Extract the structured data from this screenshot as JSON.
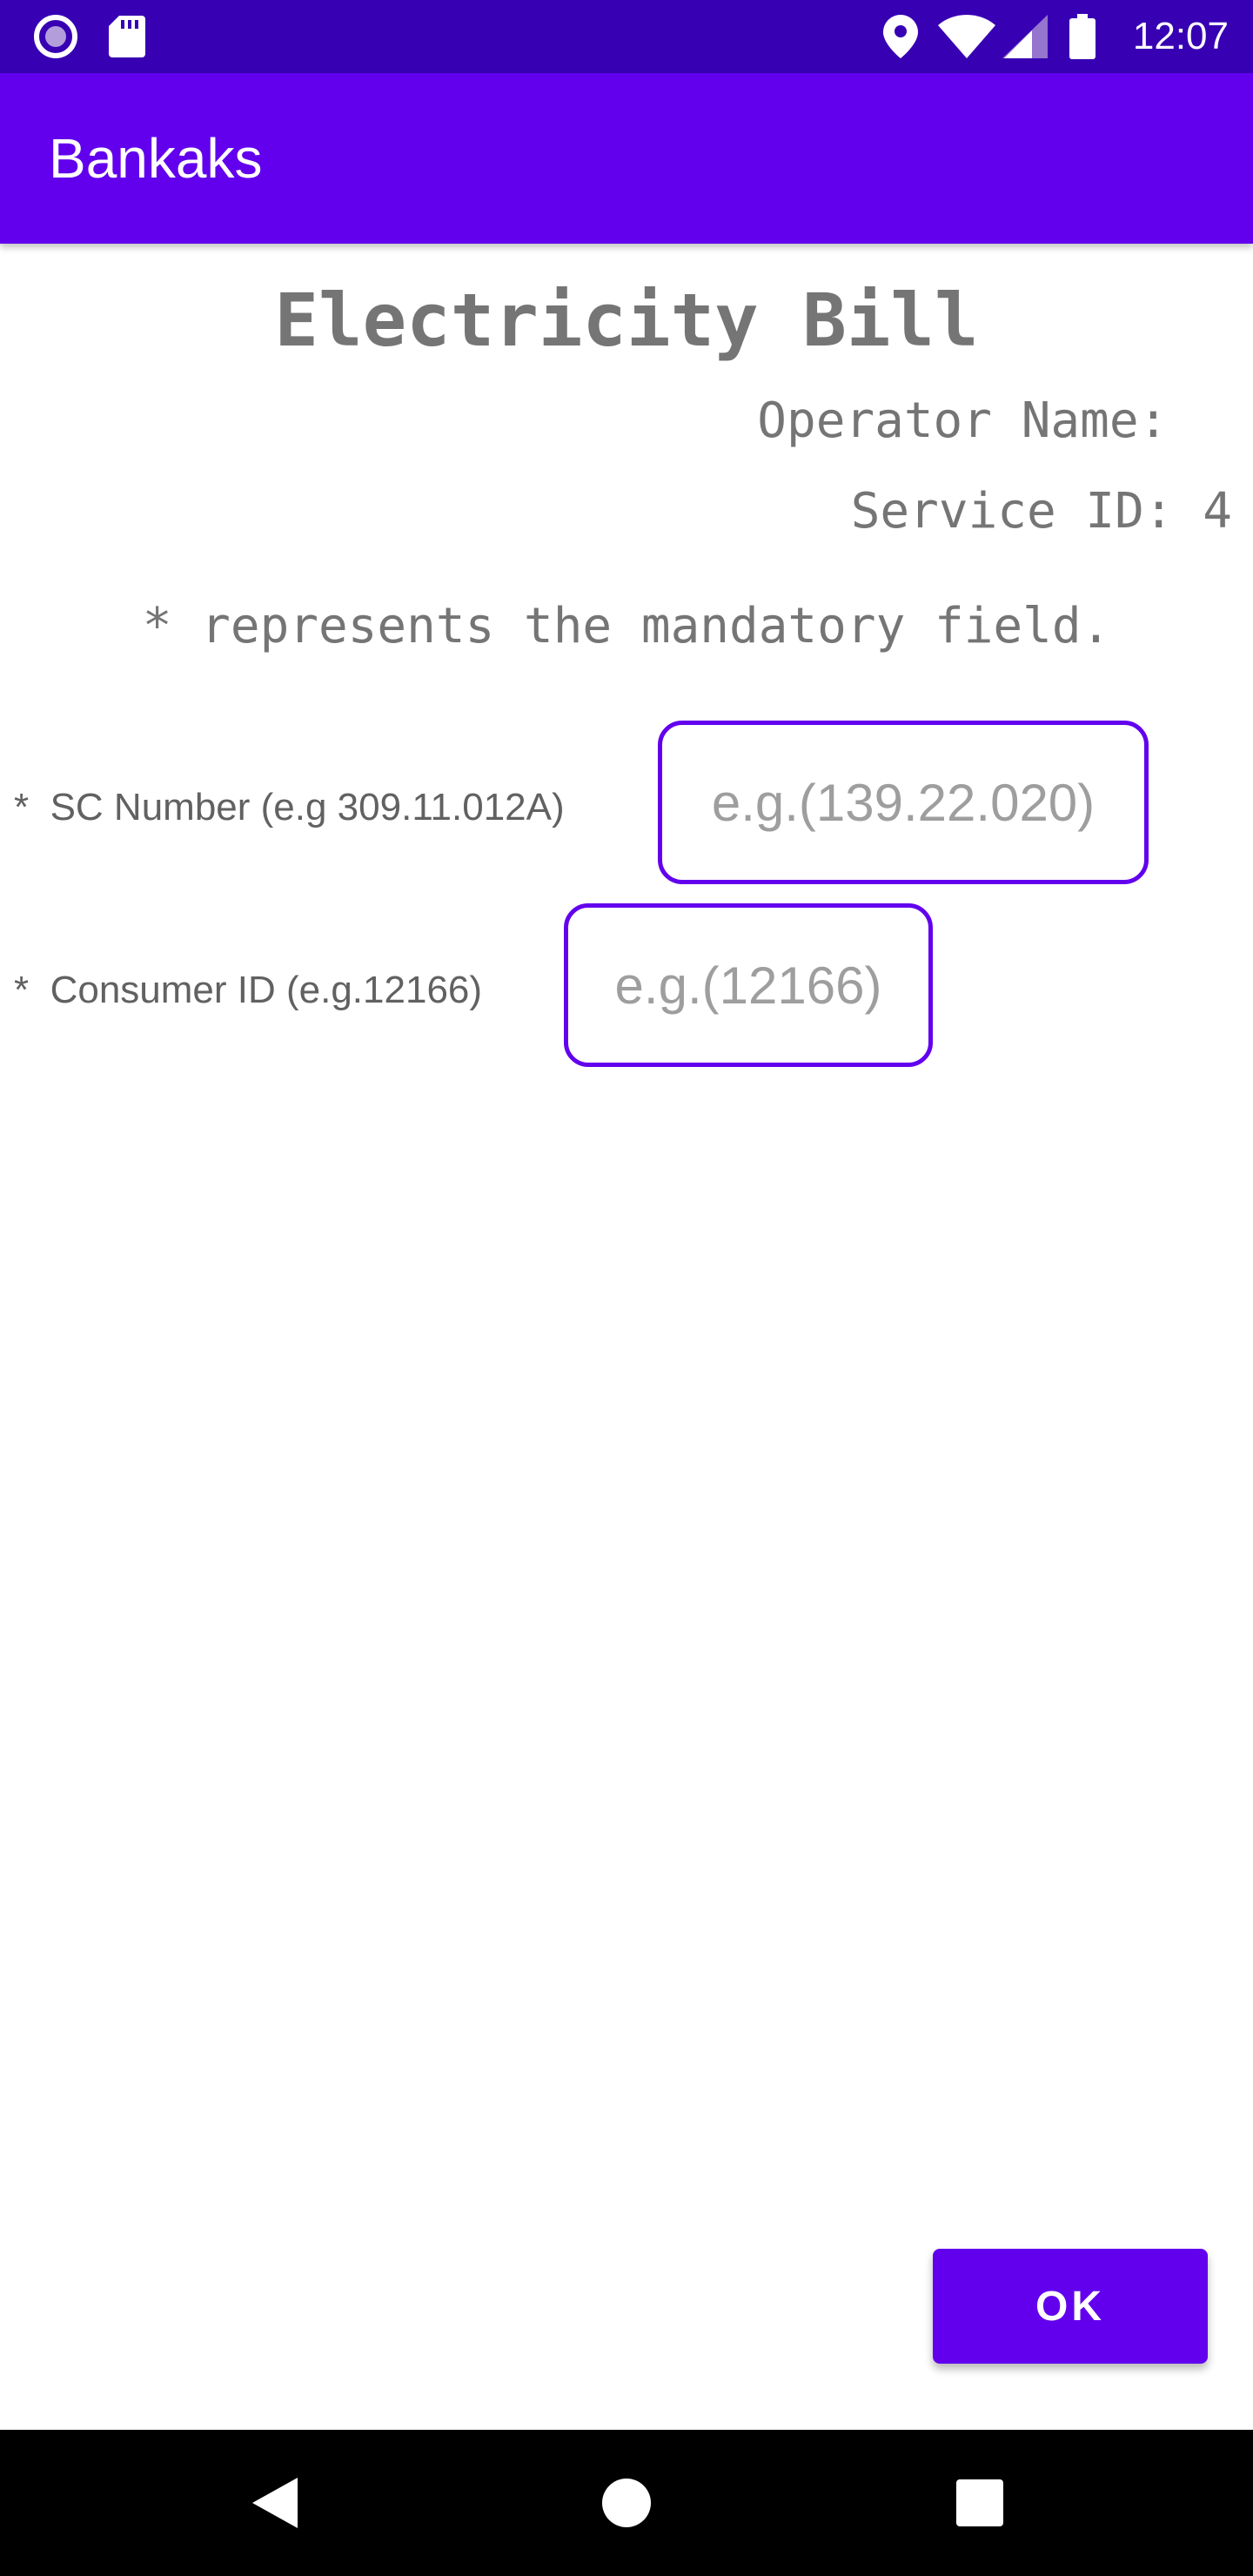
{
  "status_bar": {
    "time": "12:07",
    "left_icons": [
      "record-icon",
      "sd-card-icon"
    ],
    "right_icons": [
      "location-icon",
      "wifi-icon",
      "signal-icon",
      "battery-icon"
    ]
  },
  "app_bar": {
    "title": "Bankaks"
  },
  "page": {
    "title": "Electricity Bill",
    "operator_name": "Operator Name: ",
    "service_id": "Service ID: 4",
    "mandatory_note": "* represents the mandatory field."
  },
  "form": {
    "fields": [
      {
        "label": "*  SC Number (e.g 309.11.012A)",
        "placeholder": "e.g.(139.22.020)",
        "value": ""
      },
      {
        "label": "*  Consumer ID (e.g.12166)",
        "placeholder": "e.g.(12166)",
        "value": ""
      }
    ],
    "ok_label": "OK"
  },
  "nav_bar": {
    "buttons": [
      "back-icon",
      "home-icon",
      "recents-icon"
    ]
  },
  "colors": {
    "status_bar": "#3700b3",
    "primary": "#6200ee",
    "text_secondary": "#757575"
  }
}
